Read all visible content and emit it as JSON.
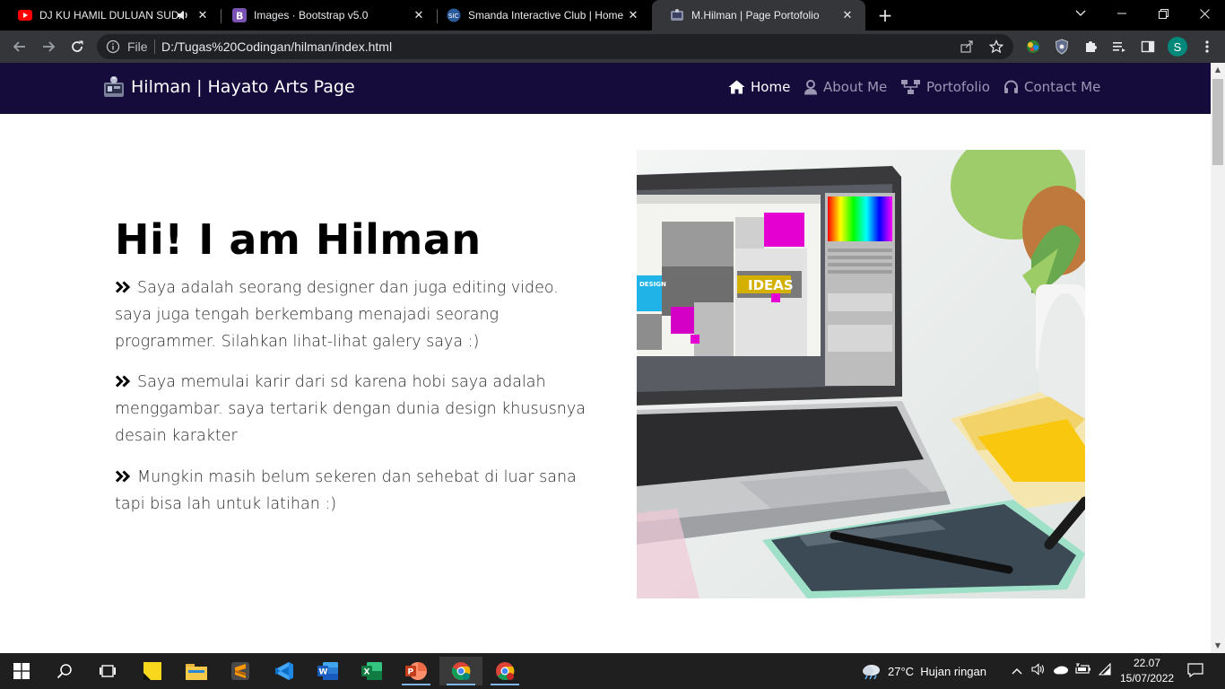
{
  "browser": {
    "tabs": [
      {
        "title": "DJ KU HAMIL DULUAN SUDA",
        "icon": "youtube-icon"
      },
      {
        "title": "Images · Bootstrap v5.0",
        "icon": "bootstrap-icon"
      },
      {
        "title": "Smanda Interactive Club | Home",
        "icon": "smanda-icon"
      },
      {
        "title": "M.Hilman | Page Portofolio",
        "icon": "hilman-favicon",
        "active": true
      }
    ],
    "address": {
      "scheme_label": "File",
      "url": "D:/Tugas%20Codingan/hilman/index.html"
    },
    "profile_initial": "S"
  },
  "page": {
    "brand": "Hilman | Hayato Arts Page",
    "nav": [
      {
        "label": "Home",
        "icon": "home-icon",
        "active": true
      },
      {
        "label": "About Me",
        "icon": "user-icon"
      },
      {
        "label": "Portofolio",
        "icon": "sitemap-icon"
      },
      {
        "label": "Contact Me",
        "icon": "headset-icon"
      }
    ],
    "hero_title": "Hi! I am Hilman",
    "paragraphs": [
      "Saya adalah seorang designer dan juga editing video. saya juga tengah berkembang menajadi seorang programmer. Silahkan lihat-lihat galery saya :)",
      "Saya memulai karir dari sd karena hobi saya adalah menggambar. saya tertarik dengan dunia design khususnya desain karakter",
      "Mungkin masih belum sekeren dan sehebat di luar sana tapi bisa lah untuk latihan :)"
    ],
    "laptop_screen_word": "IDEAS",
    "laptop_screen_word2": "DESIGN"
  },
  "taskbar": {
    "weather": "27°C  Hujan ringan",
    "time": "22.07",
    "date": "15/07/2022"
  },
  "colors": {
    "navbar": "#150c3c",
    "chrome_dark": "#35363a",
    "accent_profile": "#00897b"
  }
}
